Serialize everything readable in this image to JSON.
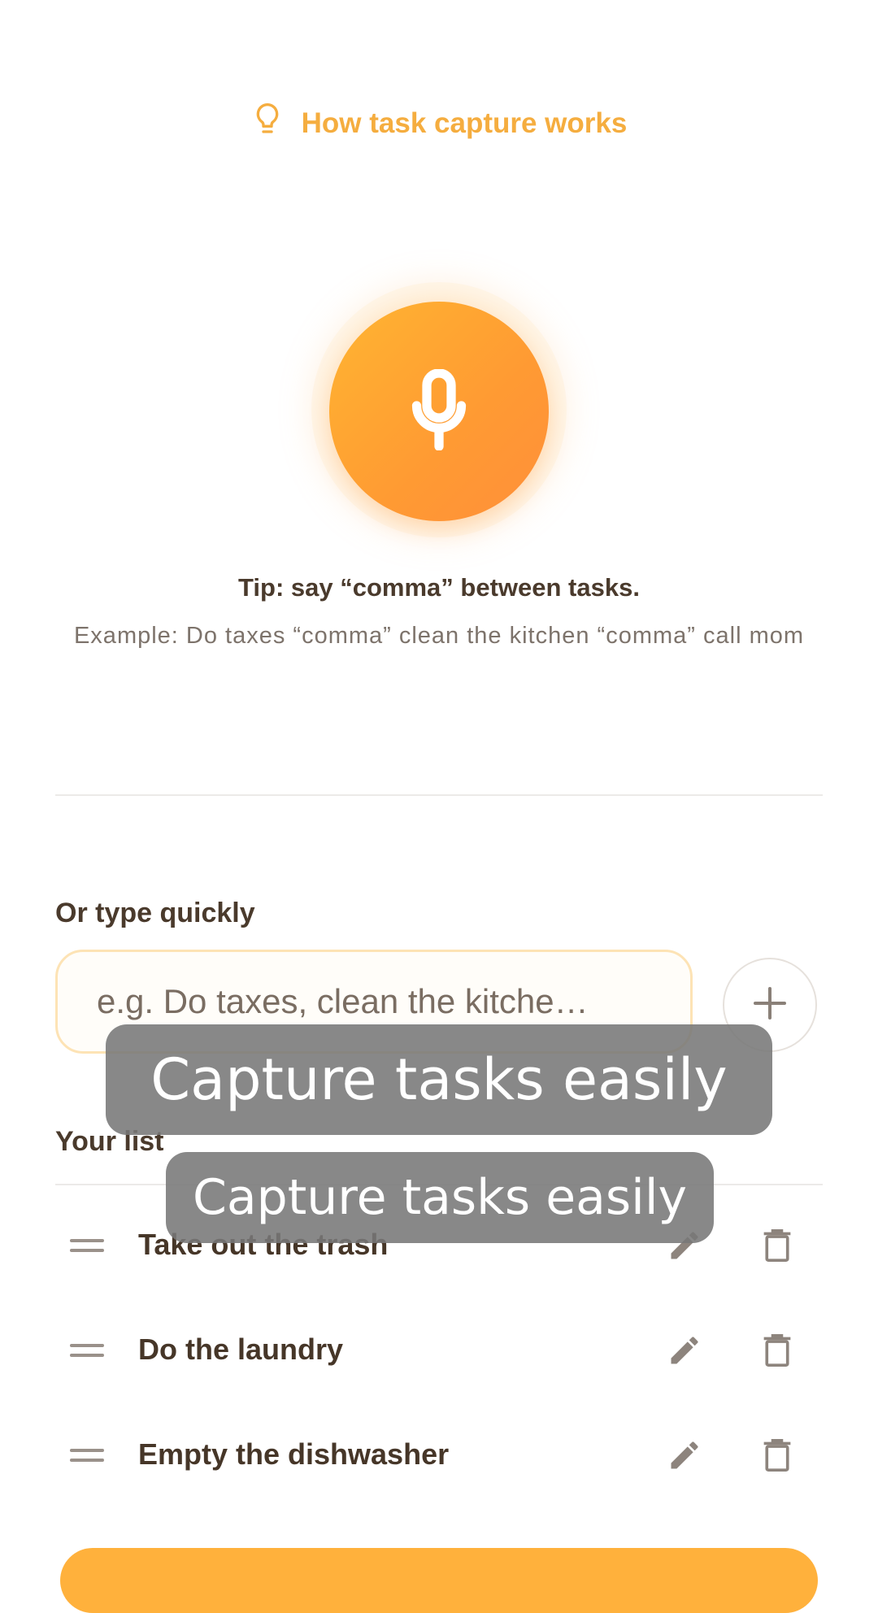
{
  "colors": {
    "accent": "#f5ad3f",
    "mic_gradient_start": "#ffb531",
    "mic_gradient_end": "#ff8f3a",
    "text_dark": "#4a3a2c",
    "text_muted": "#7d736b",
    "toast_bg": "#787878"
  },
  "help": {
    "icon": "lightbulb-icon",
    "label": "How task capture works"
  },
  "mic": {
    "icon": "microphone-icon"
  },
  "tip": {
    "title": "Tip: say “comma” between tasks.",
    "example": "Example: Do taxes “comma” clean the kitchen “comma” call mom"
  },
  "quick_entry": {
    "label": "Or type quickly",
    "placeholder": "e.g. Do taxes, clean the kitche…",
    "add_icon": "plus-icon"
  },
  "list": {
    "label": "Your list",
    "items": [
      {
        "label": "Take out the trash"
      },
      {
        "label": "Do the laundry"
      },
      {
        "label": "Empty the dishwasher"
      }
    ],
    "icons": {
      "handle": "drag-handle-icon",
      "edit": "pencil-icon",
      "delete": "trash-icon"
    }
  },
  "overlays": [
    {
      "text": "Capture tasks easily"
    },
    {
      "text": "Capture tasks easily"
    }
  ]
}
